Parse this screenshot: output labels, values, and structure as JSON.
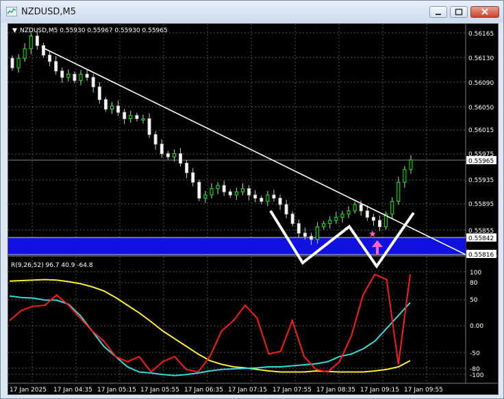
{
  "window": {
    "title": "NZDUSD,M5"
  },
  "chart": {
    "header": "NZDUSD,M5  0.55930 0.55967 0.55930 0.55965",
    "price_ticks": [
      "0.56165",
      "0.56130",
      "0.56090",
      "0.56050",
      "0.56015",
      "0.55975",
      "0.55935",
      "0.55895",
      "0.55855",
      "0.55816"
    ],
    "price_labels": {
      "current": "0.55965",
      "zone_top": "0.55842",
      "zone_bottom": "0.55816"
    },
    "time_ticks": [
      "17 Jan 2025",
      "17 Jan 04:35",
      "17 Jan 05:15",
      "17 Jan 05:55",
      "17 Jan 06:35",
      "17 Jan 07:15",
      "17 Jan 07:55",
      "17 Jan 08:35",
      "17 Jan 09:15",
      "17 Jan 09:55"
    ],
    "indicator": {
      "header": "R(9,26,52) 96.7 40.9 -64.8",
      "ticks": [
        "100",
        "80",
        "50",
        "0.00",
        "-50",
        "-80",
        "-100"
      ]
    },
    "colors": {
      "background": "#000000",
      "bull": "#00ff00",
      "bear": "#ffffff",
      "zone": "#1010e0",
      "trendline": "#ffffff",
      "arrow": "#ff66bb",
      "osc_fast": "#ff1a1a",
      "osc_mid": "#33dddd",
      "osc_slow": "#ffee33"
    }
  },
  "chart_data": {
    "type": "candlestick",
    "symbol": "NZDUSD",
    "timeframe": "M5",
    "close_series": [
      0.5611,
      0.56125,
      0.5614,
      0.5616,
      0.56145,
      0.5613,
      0.5612,
      0.56105,
      0.56095,
      0.561,
      0.5609,
      0.561,
      0.56095,
      0.5608,
      0.5606,
      0.56045,
      0.5605,
      0.5604,
      0.5603,
      0.56035,
      0.5603,
      0.5603,
      0.56005,
      0.5599,
      0.55975,
      0.5597,
      0.55975,
      0.5596,
      0.55945,
      0.5593,
      0.55905,
      0.5591,
      0.5592,
      0.55925,
      0.55915,
      0.5591,
      0.55915,
      0.5592,
      0.5591,
      0.55905,
      0.559,
      0.5591,
      0.55905,
      0.55895,
      0.5588,
      0.55865,
      0.5585,
      0.55845,
      0.5584,
      0.5586,
      0.55865,
      0.5587,
      0.55875,
      0.5588,
      0.55885,
      0.55895,
      0.55885,
      0.55875,
      0.5587,
      0.5586,
      0.5588,
      0.559,
      0.5593,
      0.5595,
      0.55965
    ],
    "levels": [
      0.55842,
      0.55816
    ],
    "current_price": 0.55965,
    "indicator": {
      "name": "R(9,26,52)",
      "values": [
        96.7,
        40.9,
        -64.8
      ],
      "ylim": [
        -100,
        100
      ]
    }
  }
}
